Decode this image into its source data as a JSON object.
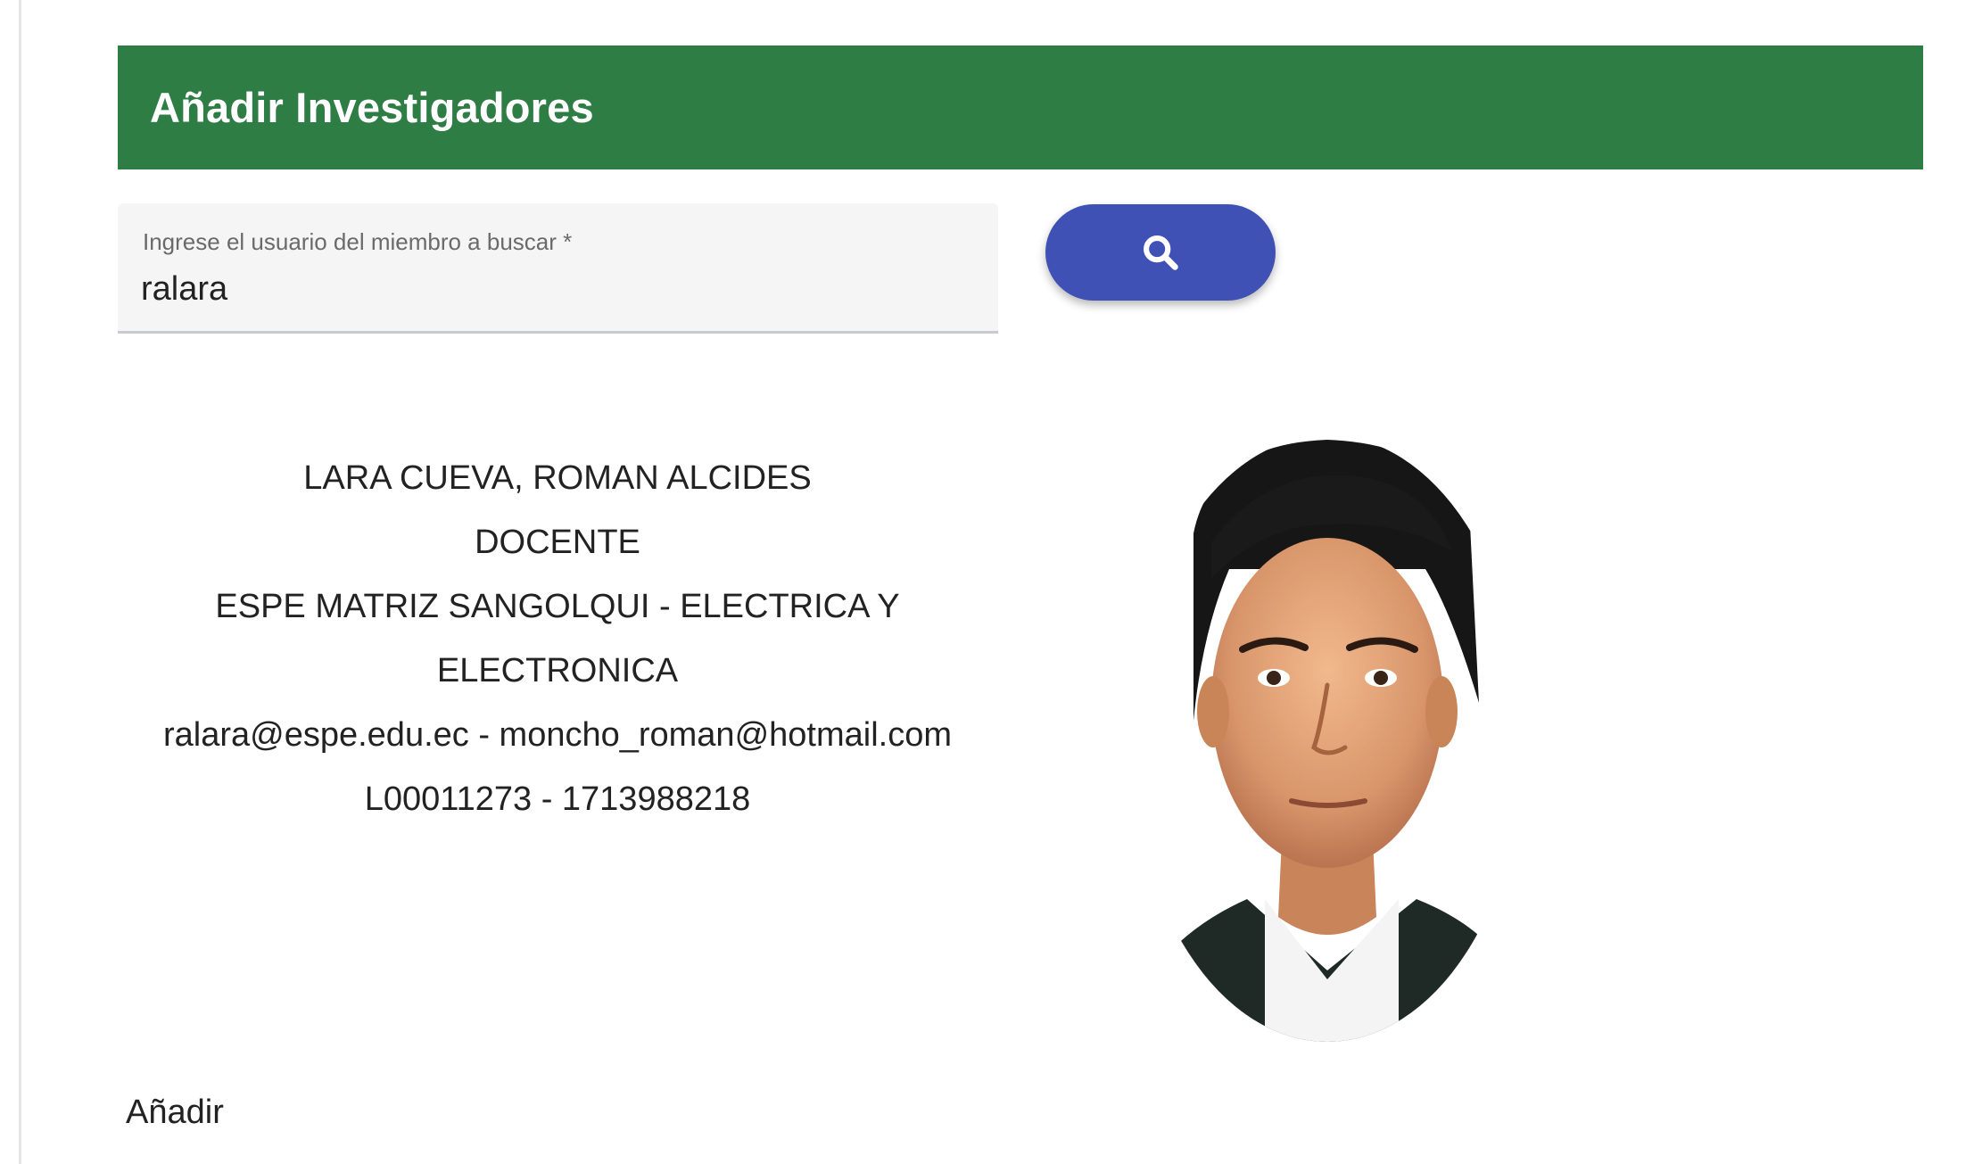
{
  "header": {
    "title": "Añadir Investigadores",
    "color": "#2e7d44"
  },
  "search": {
    "label": "Ingrese el usuario del miembro a buscar *",
    "value": "ralara",
    "button_icon": "search-icon",
    "button_color": "#3f51b5"
  },
  "member": {
    "name": "LARA CUEVA, ROMAN ALCIDES",
    "role": "DOCENTE",
    "department_line1": "ESPE MATRIZ SANGOLQUI - ELECTRICA Y",
    "department_line2": "ELECTRONICA",
    "emails": "ralara@espe.edu.ec - moncho_roman@hotmail.com",
    "ids": "L00011273 - 1713988218"
  },
  "actions": {
    "add_label": "Añadir"
  }
}
